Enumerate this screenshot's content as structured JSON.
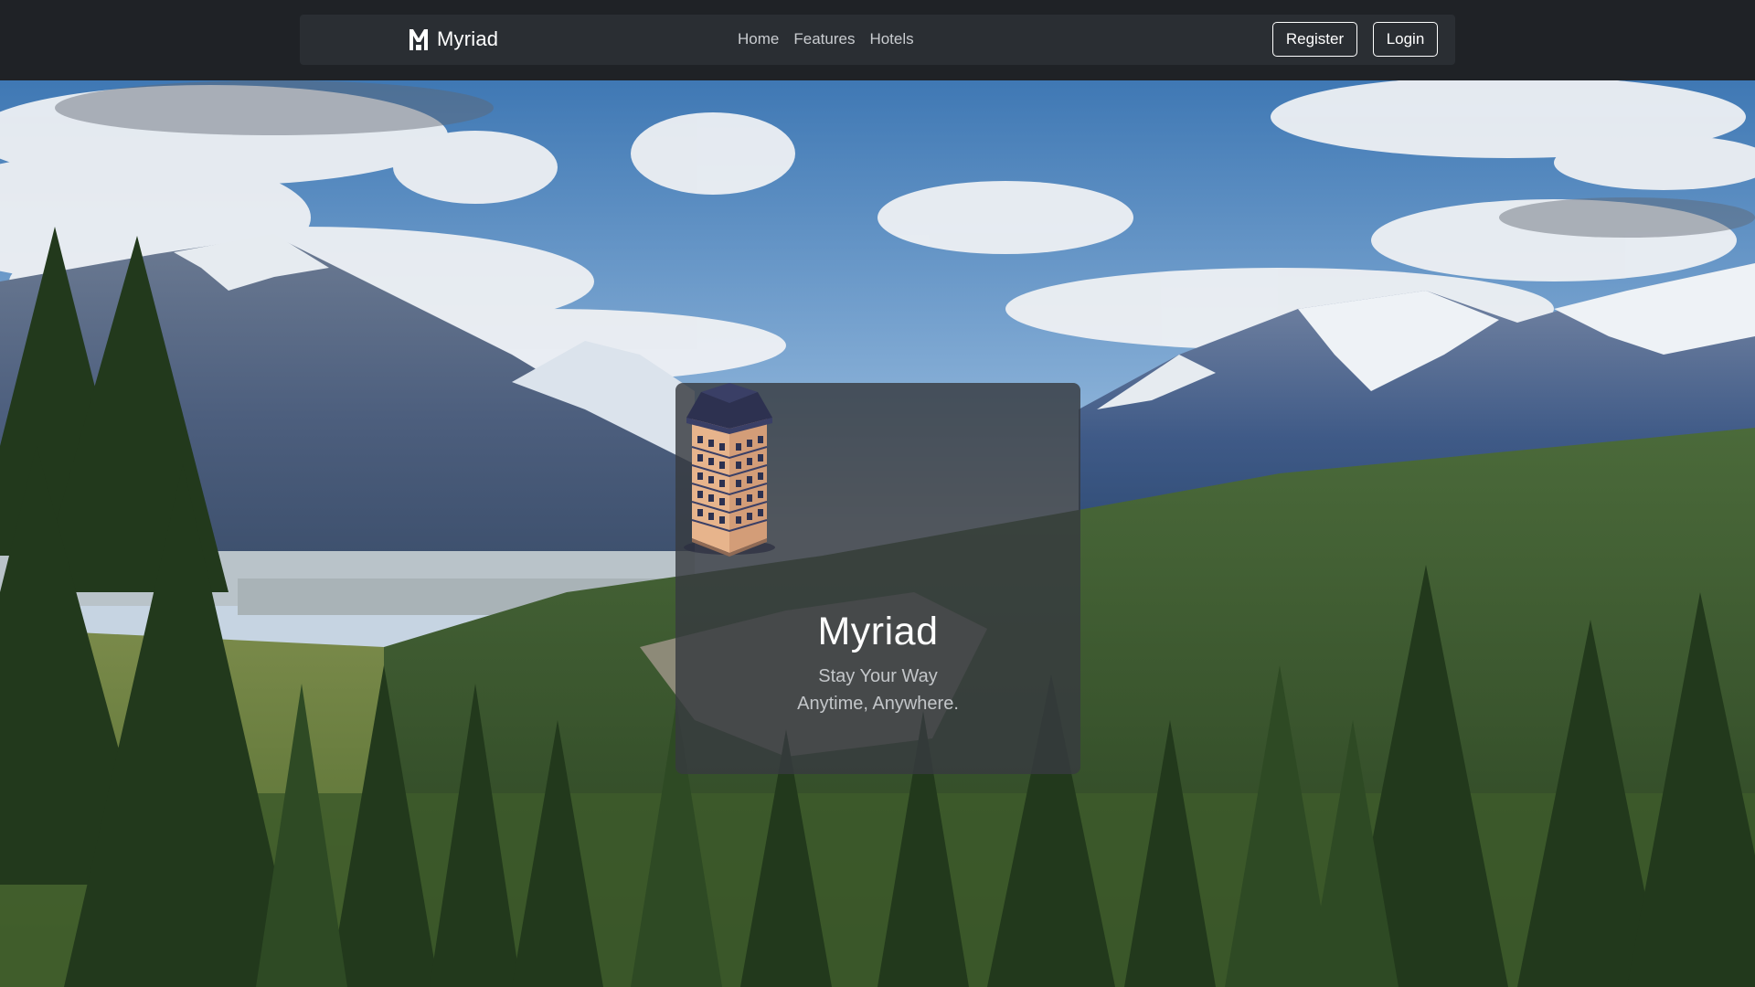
{
  "navbar": {
    "brand_name": "Myriad",
    "links": [
      {
        "label": "Home"
      },
      {
        "label": "Features"
      },
      {
        "label": "Hotels"
      }
    ],
    "register_label": "Register",
    "login_label": "Login"
  },
  "hero": {
    "background_description": "mountain landscape with forest",
    "card": {
      "title": "Myriad",
      "tagline_line1": "Stay Your Way",
      "tagline_line2": "Anytime, Anywhere."
    }
  },
  "colors": {
    "topbar_bg": "#1f2226",
    "navbar_bg": "#2a2e33",
    "card_bg": "#373a3f",
    "text_primary": "#ffffff",
    "text_muted": "#c3c6c9"
  },
  "icons": {
    "brand_logo": "myriad-m-logo",
    "hotel_illustration": "hotel-building-illustration"
  }
}
